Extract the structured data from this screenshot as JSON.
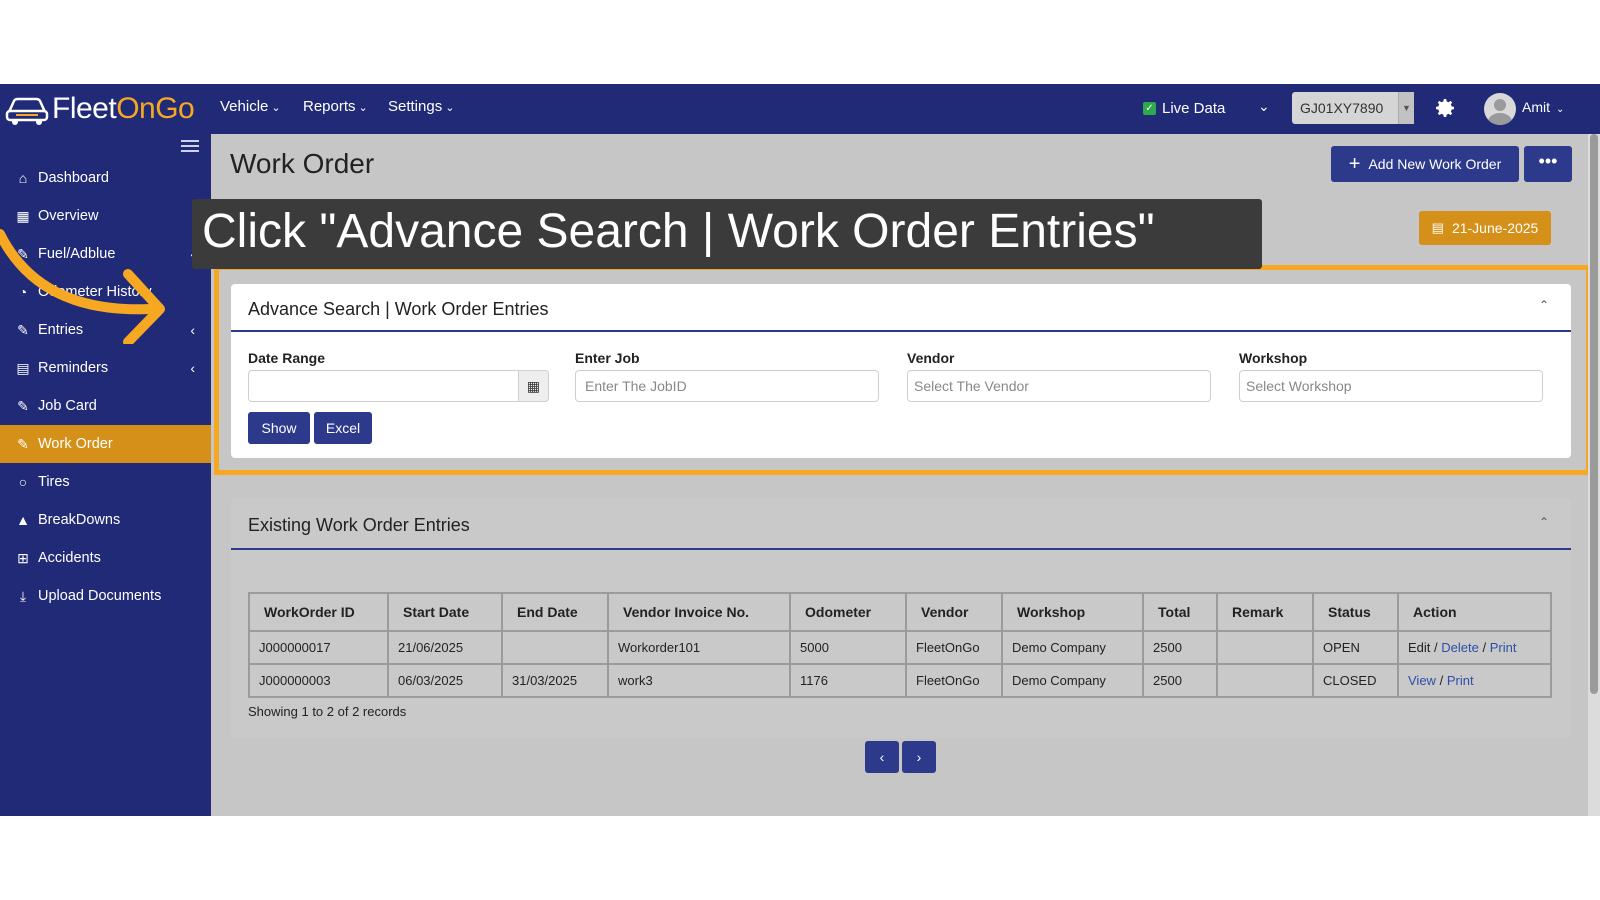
{
  "app": {
    "brand_part1": "Fleet",
    "brand_part2": "OnGo"
  },
  "topnav": [
    {
      "label": "Vehicle"
    },
    {
      "label": "Reports"
    },
    {
      "label": "Settings"
    }
  ],
  "header_right": {
    "live_label": "Live Data",
    "vehicle_value": "GJ01XY7890",
    "user_name": "Amit"
  },
  "sidebar": {
    "items": [
      {
        "label": "Dashboard",
        "icon": "home-icon"
      },
      {
        "label": "Overview",
        "icon": "grid-icon"
      },
      {
        "label": "Fuel/Adblue",
        "icon": "edit-icon"
      },
      {
        "label": "Odometer History",
        "icon": "gauge-icon"
      },
      {
        "label": "Entries",
        "icon": "edit-icon"
      },
      {
        "label": "Reminders",
        "icon": "calendar-icon"
      },
      {
        "label": "Job Card",
        "icon": "edit-icon"
      },
      {
        "label": "Work Order",
        "icon": "edit-icon"
      },
      {
        "label": "Tires",
        "icon": "circle-icon"
      },
      {
        "label": "BreakDowns",
        "icon": "warning-icon"
      },
      {
        "label": "Accidents",
        "icon": "plus-square-icon"
      },
      {
        "label": "Upload Documents",
        "icon": "download-icon"
      }
    ]
  },
  "page": {
    "title": "Work Order",
    "add_button": "Add New Work Order",
    "date_button": "21-June-2025"
  },
  "search": {
    "title": "Advance Search | Work Order Entries",
    "date_range_label": "Date Range",
    "job_label": "Enter Job",
    "job_placeholder": "Enter The JobID",
    "vendor_label": "Vendor",
    "vendor_placeholder": "Select The Vendor",
    "workshop_label": "Workshop",
    "workshop_placeholder": "Select Workshop",
    "show_button": "Show",
    "excel_button": "Excel"
  },
  "entries": {
    "title": "Existing Work Order Entries",
    "columns": [
      "WorkOrder ID",
      "Start Date",
      "End Date",
      "Vendor Invoice No.",
      "Odometer",
      "Vendor",
      "Workshop",
      "Total",
      "Remark",
      "Status",
      "Action"
    ],
    "rows": [
      {
        "id": "J000000017",
        "start": "21/06/2025",
        "end": "",
        "invoice": "Workorder101",
        "odometer": "5000",
        "vendor": "FleetOnGo",
        "workshop": "Demo Company",
        "total": "2500",
        "remark": "",
        "status": "OPEN",
        "actions": [
          "Edit",
          "Delete",
          "Print"
        ]
      },
      {
        "id": "J000000003",
        "start": "06/03/2025",
        "end": "31/03/2025",
        "invoice": "work3",
        "odometer": "1176",
        "vendor": "FleetOnGo",
        "workshop": "Demo Company",
        "total": "2500",
        "remark": "",
        "status": "CLOSED",
        "actions": [
          "View",
          "Print"
        ]
      }
    ],
    "records": "Showing 1 to 2 of 2 records",
    "separator": "/"
  },
  "pagination": {
    "prev": "‹",
    "next": "›"
  },
  "overlay": {
    "caption": "Click \"Advance Search | Work Order Entries\""
  },
  "colors": {
    "navy": "#202a76",
    "accent": "#d5901a",
    "highlight": "#f7a823",
    "button": "#2d3a8c"
  }
}
